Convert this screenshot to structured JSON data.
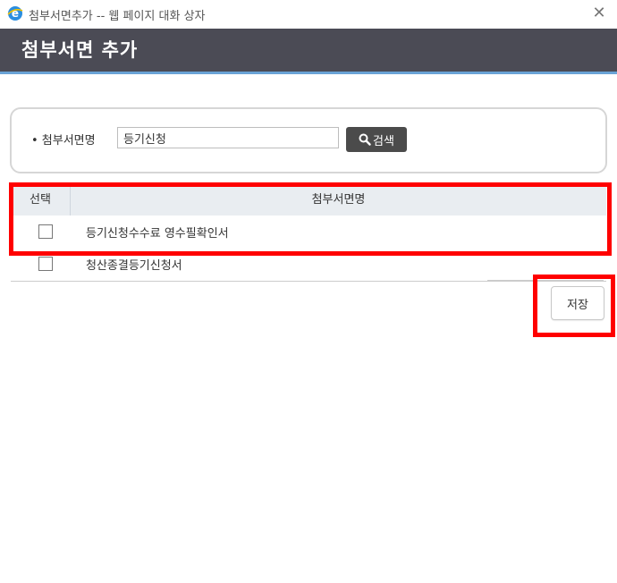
{
  "window": {
    "title": "첨부서면추가 -- 웹 페이지 대화 상자",
    "close_glyph": "✕"
  },
  "header": {
    "title": "첨부서면 추가"
  },
  "search": {
    "label": "• 첨부서면명",
    "value": "등기신청",
    "button_label": "검색"
  },
  "table": {
    "columns": [
      "선택",
      "첨부서면명"
    ],
    "rows": [
      {
        "name": "등기신청수수료 영수필확인서",
        "checked": false
      },
      {
        "name": "청산종결등기신청서",
        "checked": false
      }
    ]
  },
  "actions": {
    "save_label": "저장"
  },
  "colors": {
    "header_bg": "#4b4b55",
    "header_accent": "#6aa3d6",
    "highlight": "#ff0000",
    "search_button_bg": "#4b4b4b"
  },
  "icons": {
    "app": "ie-icon",
    "search": "search-icon",
    "close": "close-icon"
  }
}
